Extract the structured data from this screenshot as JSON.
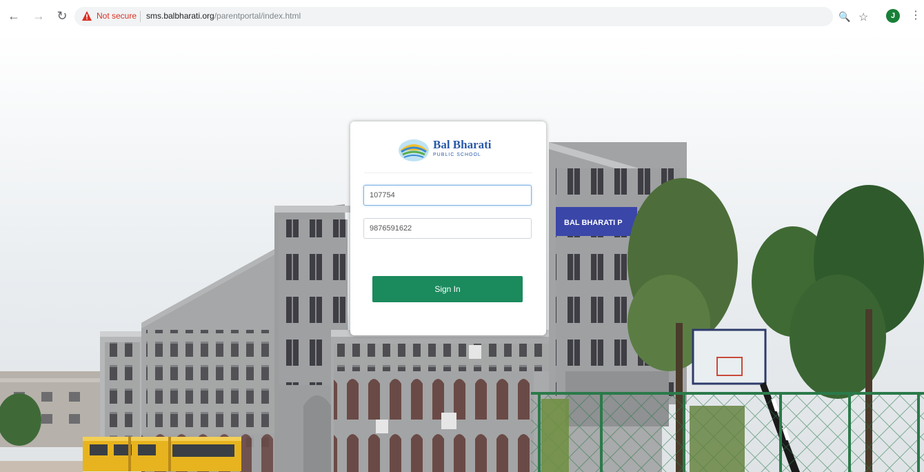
{
  "browser": {
    "security_warning": "Not secure",
    "url_host": "sms.balbharati.org",
    "url_path": "/parentportal/index.html",
    "profile_initial": "J",
    "icons": [
      "back-icon",
      "forward-icon",
      "reload-icon",
      "warning-icon",
      "zoom-icon",
      "star-icon",
      "profile-avatar",
      "more-menu-icon"
    ]
  },
  "background": {
    "building_banner": "BAL BHARATI P"
  },
  "login": {
    "logo_name": "Bal Bharati",
    "logo_subtitle": "PUBLIC SCHOOL",
    "username_value": "107754",
    "password_value": "9876591622",
    "signin_label": "Sign In",
    "accent_color": "#1b8a5d"
  }
}
